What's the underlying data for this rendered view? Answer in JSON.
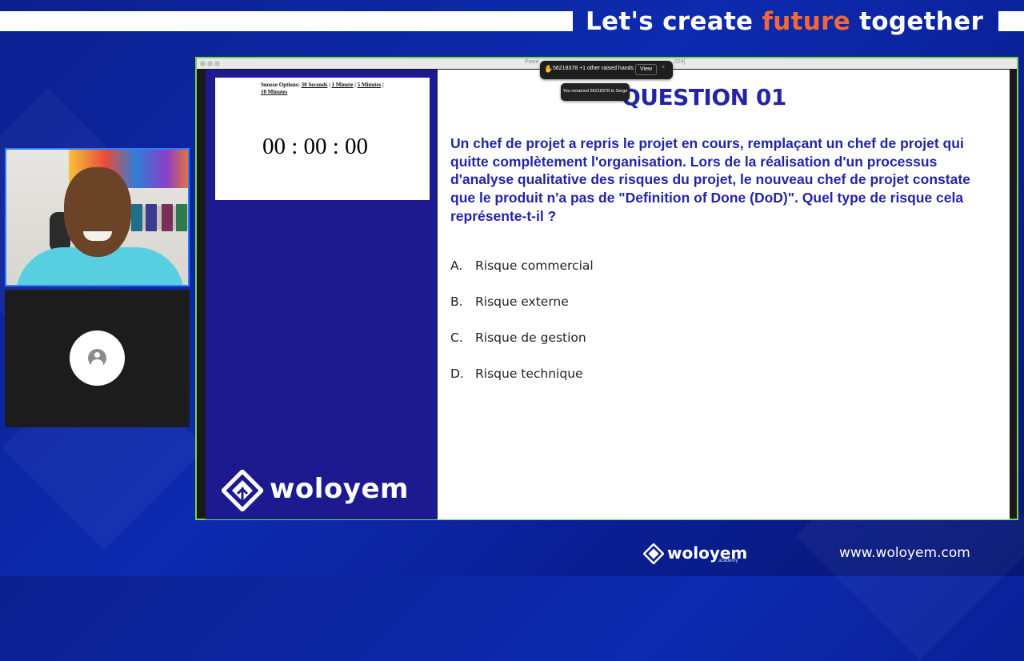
{
  "banner": {
    "title_before": "Let's create ",
    "title_accent": "future",
    "title_after": " together"
  },
  "participants": {
    "avatar_icon": "person-avatar-icon"
  },
  "shared_window": {
    "title_fragment": "Powe",
    "title_suffix": "024]"
  },
  "notifications": {
    "raised_hands": {
      "icon": "raised-hand-icon",
      "text": "56218378 +1 other raised hands",
      "view_label": "View",
      "close_label": "×"
    },
    "rename": {
      "text": "You renamed 56218378 to Serge"
    }
  },
  "slide": {
    "timer": {
      "snooze_label": "Snooze Options:",
      "snooze_options": [
        "30 Seconds",
        "1 Minute",
        "5 Minutes",
        "10 Minutes"
      ],
      "separator": " | ",
      "value": "00 : 00 : 00"
    },
    "brand_word": "woloyem",
    "question_title": "QUESTION 01",
    "question_text": "Un chef de projet a repris le projet en cours, remplaçant un chef de projet qui quitte complètement l'organisation. Lors de la réalisation d'un processus d'analyse qualitative des risques du projet, le nouveau chef de projet constate que le produit n'a pas de \"Definition of Done (DoD)\". Quel type de risque cela représente-t-il ?",
    "answers": [
      {
        "letter": "A.",
        "text": "Risque commercial"
      },
      {
        "letter": "B.",
        "text": "Risque externe"
      },
      {
        "letter": "C.",
        "text": "Risque de gestion"
      },
      {
        "letter": "D.",
        "text": "Risque technique"
      }
    ]
  },
  "footer": {
    "brand": "woloyem",
    "brand_sub": "academy",
    "url": "www.woloyem.com"
  },
  "colors": {
    "background": "#0d2bb0",
    "accent": "#f2673a",
    "slide_navy": "#1c1a8e",
    "question_blue": "#2325a6",
    "share_border": "#7ad34a"
  }
}
